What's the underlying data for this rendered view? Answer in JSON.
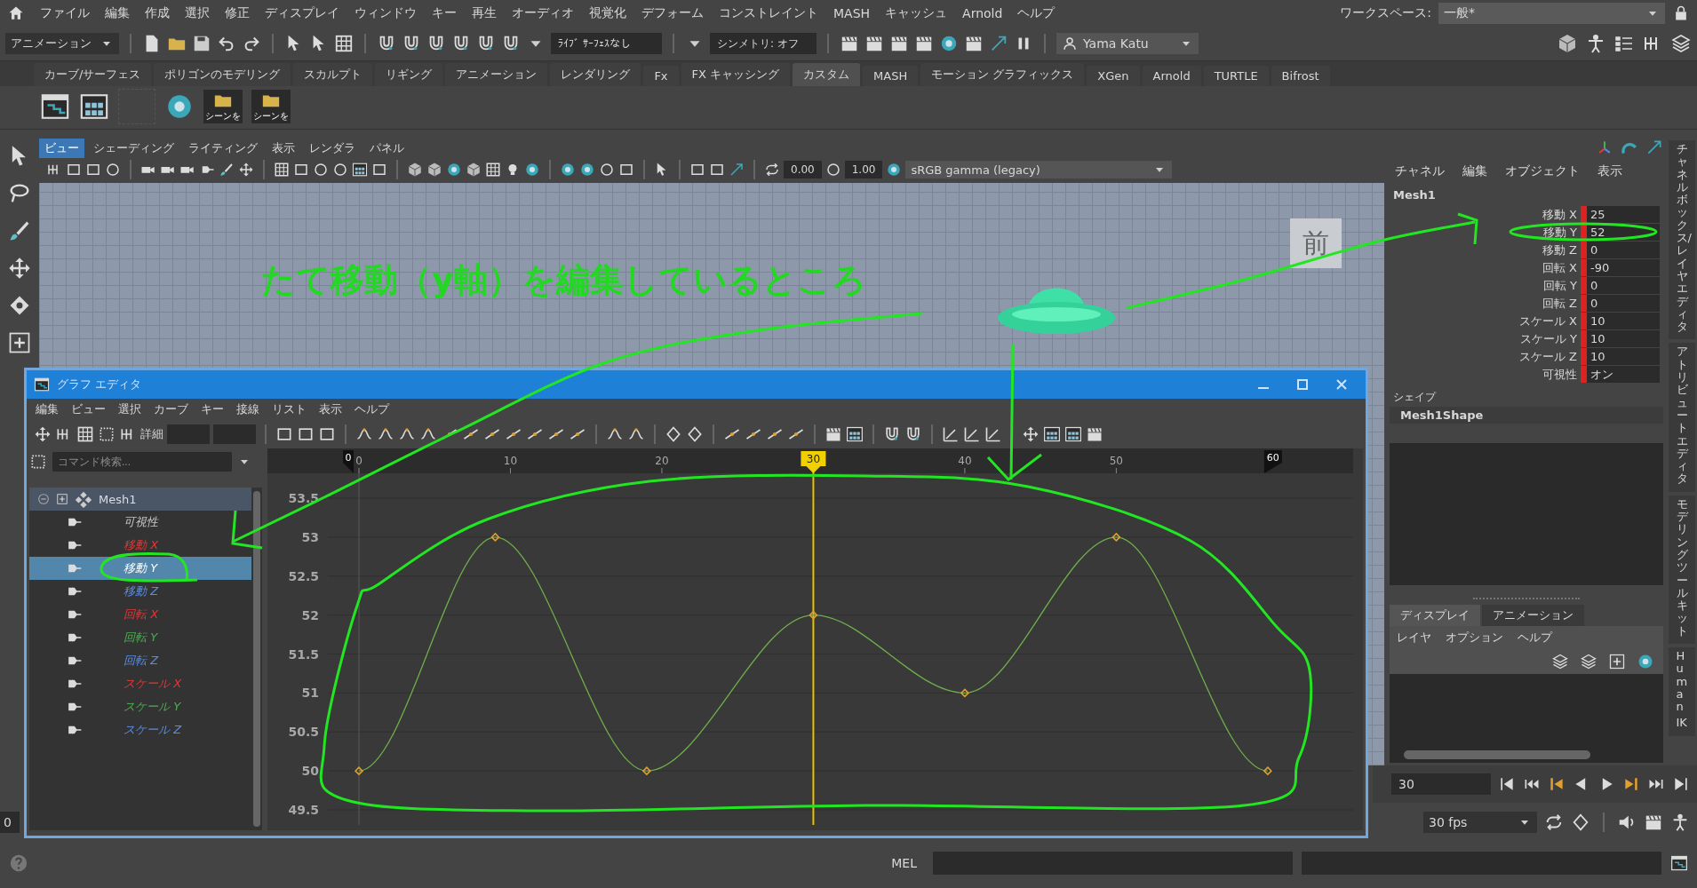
{
  "menu_bar": {
    "items": [
      "ファイル",
      "編集",
      "作成",
      "選択",
      "修正",
      "ディスプレイ",
      "ウィンドウ",
      "キー",
      "再生",
      "オーディオ",
      "視覚化",
      "デフォーム",
      "コンストレイント",
      "MASH",
      "キャッシュ",
      "Arnold",
      "ヘルプ"
    ],
    "workspace_label": "ワークスペース:",
    "workspace": "一般*"
  },
  "status_line": {
    "mode": "アニメーション",
    "live_surface": "ﾗｲﾌﾞ ｻｰﾌｪｽなし",
    "symmetry": "シンメトリ: オフ",
    "user": "Yama Katu"
  },
  "shelf": {
    "tabs": [
      {
        "label": "カーブ/サーフェス",
        "selected": false
      },
      {
        "label": "ポリゴンのモデリング",
        "selected": false
      },
      {
        "label": "スカルプト",
        "selected": false
      },
      {
        "label": "リギング",
        "selected": false
      },
      {
        "label": "アニメーション",
        "selected": false
      },
      {
        "label": "レンダリング",
        "selected": false
      },
      {
        "label": "Fx",
        "selected": false
      },
      {
        "label": "FX キャッシング",
        "selected": false
      },
      {
        "label": "カスタム",
        "selected": true
      },
      {
        "label": "MASH",
        "selected": false
      },
      {
        "label": "モーション グラフィックス",
        "selected": false
      },
      {
        "label": "XGen",
        "selected": false
      },
      {
        "label": "Arnold",
        "selected": false
      },
      {
        "label": "TURTLE",
        "selected": false
      },
      {
        "label": "Bifrost",
        "selected": false
      }
    ],
    "buttons": [
      "シーンを",
      "シーンを"
    ]
  },
  "viewport": {
    "menu": [
      {
        "label": "ビュー",
        "selected": true
      },
      {
        "label": "シェーディング",
        "selected": false
      },
      {
        "label": "ライティング",
        "selected": false
      },
      {
        "label": "表示",
        "selected": false
      },
      {
        "label": "レンダラ",
        "selected": false
      },
      {
        "label": "パネル",
        "selected": false
      }
    ],
    "exposure": "0.00",
    "gamma": "1.00",
    "color_space": "sRGB gamma (legacy)",
    "view_label": "前",
    "note": "たて移動（y軸）を編集しているところ"
  },
  "graph_editor": {
    "title": "グラフ エディタ",
    "menu": [
      "編集",
      "ビュー",
      "選択",
      "カーブ",
      "キー",
      "接線",
      "リスト",
      "表示",
      "ヘルプ"
    ],
    "detail_label": "詳細",
    "search_placeholder": "コマンド検索...",
    "outliner": {
      "name": "Mesh1",
      "expanded": true,
      "children": [
        {
          "label": "可視性",
          "color": "#c8c8c8",
          "selected": false
        },
        {
          "label": "移動 X",
          "color": "#e03838",
          "selected": false
        },
        {
          "label": "移動 Y",
          "selected": true
        },
        {
          "label": "移動 Z",
          "color": "#5b8de0",
          "selected": false
        },
        {
          "label": "回転 X",
          "color": "#e03838",
          "selected": false
        },
        {
          "label": "回転 Y",
          "color": "#4caf50",
          "selected": false
        },
        {
          "label": "回転 Z",
          "color": "#5b8de0",
          "selected": false
        },
        {
          "label": "スケール X",
          "color": "#e03838",
          "selected": false
        },
        {
          "label": "スケール Y",
          "color": "#4caf50",
          "selected": false
        },
        {
          "label": "スケール Z",
          "color": "#5b8de0",
          "selected": false
        }
      ]
    },
    "range_start": "0",
    "range_end": "60",
    "current_frame": "30",
    "chart_data": {
      "type": "line",
      "grid": true,
      "ref_lines": [
        {
          "axis": "x",
          "value": 30
        }
      ],
      "x": [
        0,
        9,
        19,
        30,
        40,
        50,
        60
      ],
      "series": [
        {
          "color": "#6fae4a",
          "marker": "diamond",
          "values": [
            50,
            53,
            50,
            52,
            51,
            53,
            50
          ]
        }
      ],
      "xlim": [
        0,
        63
      ],
      "ylim": [
        49.5,
        53.5
      ],
      "xticks": [
        0,
        10,
        20,
        40,
        50
      ],
      "yticks": [
        49.5,
        50,
        50.5,
        51,
        51.5,
        52,
        52.5,
        53,
        53.5
      ]
    }
  },
  "channel_box": {
    "menu": [
      "チャネル",
      "編集",
      "オブジェクト",
      "表示"
    ],
    "object": "Mesh1",
    "channels": [
      {
        "label": "移動 X",
        "value": "25",
        "keyed": true
      },
      {
        "label": "移動 Y",
        "value": "52",
        "keyed": true
      },
      {
        "label": "移動 Z",
        "value": "0",
        "keyed": true
      },
      {
        "label": "回転 X",
        "value": "-90",
        "keyed": true
      },
      {
        "label": "回転 Y",
        "value": "0",
        "keyed": true
      },
      {
        "label": "回転 Z",
        "value": "0",
        "keyed": true
      },
      {
        "label": "スケール X",
        "value": "10",
        "keyed": true
      },
      {
        "label": "スケール Y",
        "value": "10",
        "keyed": true
      },
      {
        "label": "スケール Z",
        "value": "10",
        "keyed": true
      },
      {
        "label": "可視性",
        "value": "オン",
        "keyed": true
      }
    ],
    "shape_label": "シェイプ",
    "shape": "Mesh1Shape"
  },
  "layer_editor": {
    "tabs": [
      {
        "label": "ディスプレイ",
        "selected": true
      },
      {
        "label": "アニメーション",
        "selected": false
      }
    ],
    "menu": [
      "レイヤ",
      "オプション",
      "ヘルプ"
    ]
  },
  "side_tabs": [
    "チャネルボックス/レイヤエディタ",
    "アトリビュートエディタ",
    "モデリングツールキット",
    "Human IK"
  ],
  "time_slider": {
    "current_frame": "30",
    "start": "0",
    "fps": "30 fps"
  },
  "command_line": {
    "language": "MEL"
  }
}
